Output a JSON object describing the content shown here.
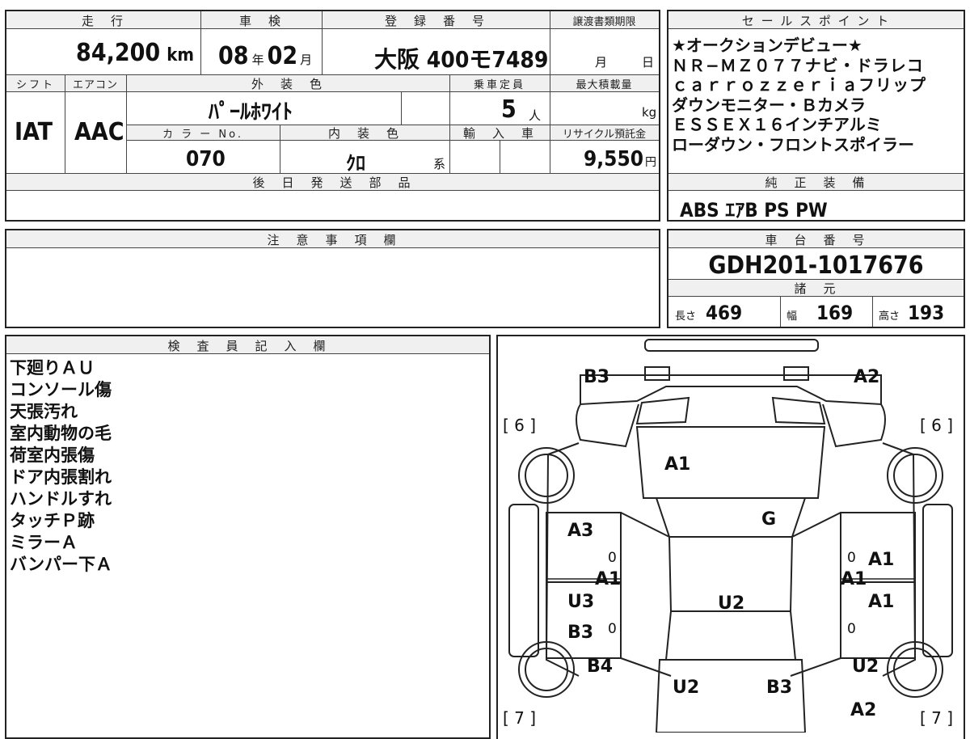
{
  "top_cells": {
    "mileage_label": "走　行",
    "mileage_value": "84,200",
    "mileage_unit": "km",
    "shaken_label": "車　検",
    "shaken_year": "08",
    "shaken_year_unit": "年",
    "shaken_month": "02",
    "shaken_month_unit": "月",
    "reg_label": "登　録　番　号",
    "reg_value": "大阪 400モ7489",
    "deadline_label": "譲渡書類期限",
    "deadline_month": "月",
    "deadline_day": "日"
  },
  "row2": {
    "shift_label": "シフト",
    "aircon_label": "エアコン",
    "exterior_label": "外　装　色",
    "capacity_label": "乗車定員",
    "maxload_label": "最大積載量",
    "shift_value": "IAT",
    "aircon_value": "AAC",
    "exterior_value": "ﾊﾟｰﾙﾎﾜｲﾄ",
    "capacity_value": "5",
    "capacity_unit": "人",
    "maxload_unit": "kg",
    "color_no_label": "カ ラ ー No.",
    "interior_label": "内　装　色",
    "import_label": "輸　入　車",
    "recycle_label": "リサイクル預託金",
    "color_no_value": "070",
    "interior_value": "ｸﾛ",
    "interior_suffix": "系",
    "recycle_value": "9,550",
    "recycle_unit": "円"
  },
  "later_parts": {
    "label": "後　日　発　送　部　品"
  },
  "notes": {
    "label": "注　意　事　項　欄"
  },
  "sales": {
    "label": "セ ー ル ス ポ イ ン ト",
    "lines": [
      "★オークションデビュー★",
      "ＮＲ−ＭＺ０７７ナビ・ドラレコ",
      "ｃａｒｒｏｚｚｅｒｉａフリップ",
      "ダウンモニター・Ｂカメラ",
      "ＥＳＳＥＸ１６インチアルミ",
      "ローダウン・フロントスポイラー"
    ]
  },
  "equipment": {
    "label": "純　正　装　備",
    "value": "ABS ｴｱB PS PW"
  },
  "chassis": {
    "label": "車　台　番　号",
    "value": "GDH201-1017676"
  },
  "specs": {
    "label": "諸　元",
    "length_label": "長さ",
    "length_value": "469",
    "width_label": "幅",
    "width_value": "169",
    "height_label": "高さ",
    "height_value": "193"
  },
  "inspector": {
    "label": "検　査　員　記　入　欄",
    "lines": [
      "下廻りＡＵ",
      "コンソール傷",
      "天張汚れ",
      "室内動物の毛",
      "荷室内張傷",
      "ドア内張割れ",
      "ハンドルすれ",
      "タッチＰ跡",
      "ミラーＡ",
      "バンパー下Ａ"
    ]
  },
  "diagram": {
    "tire_front_left": "[ 6 ]",
    "tire_front_right": "[ 6 ]",
    "tire_rear_left": "[ 7 ]",
    "tire_rear_right": "[ 7 ]",
    "markers": {
      "b3_top_left": "B3",
      "a2_top_right": "A2",
      "a1_hood": "A1",
      "g_windshield": "G",
      "a3_left_front_door": "A3",
      "a1_left_sill": "A1",
      "u3_left_rear_door": "U3",
      "b3_left_rear_door": "B3",
      "b4_left_rear": "B4",
      "a1_right_front_door": "A1",
      "a1_right_sill": "A1",
      "a1_right_rear_door": "A1",
      "u2_right_rear": "U2",
      "a2_right_rear": "A2",
      "u2_roof": "U2",
      "u2_rear_left": "U2",
      "b3_rear_right": "B3"
    },
    "zeros": [
      "0",
      "0",
      "0",
      "0"
    ]
  }
}
